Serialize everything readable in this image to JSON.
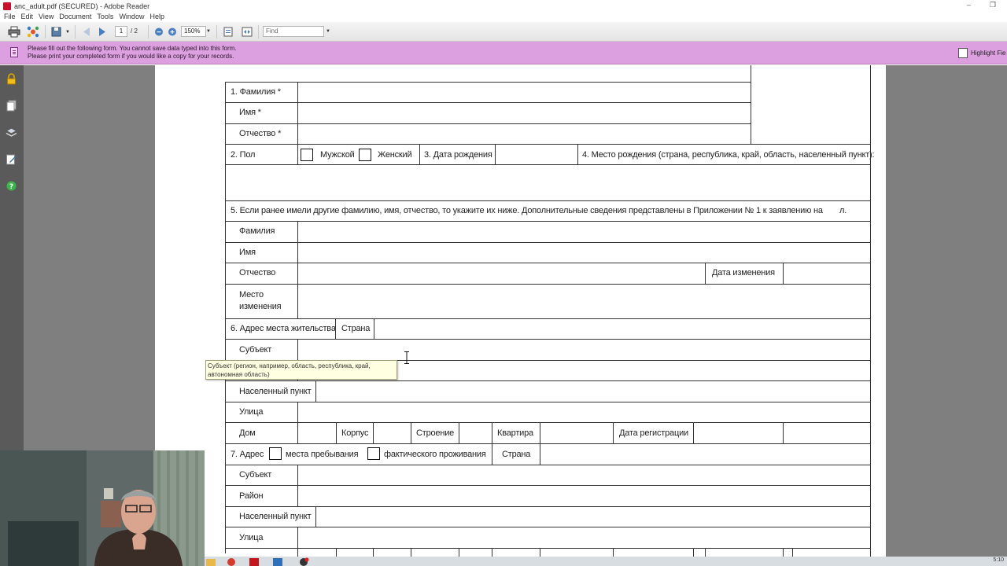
{
  "window": {
    "title": "anc_adult.pdf (SECURED) - Adobe Reader",
    "controls": [
      "–",
      "❐"
    ]
  },
  "menu": [
    "File",
    "Edit",
    "View",
    "Document",
    "Tools",
    "Window",
    "Help"
  ],
  "toolbar": {
    "page_current": "1",
    "page_total": "/ 2",
    "zoom": "150%",
    "find_placeholder": "Find"
  },
  "message_bar": {
    "line1": "Please fill out the following form. You cannot save data typed into this form.",
    "line2": "Please print your completed form if you would like a copy for your records.",
    "highlight_button": "Highlight Fie"
  },
  "form": {
    "surname_label": "1. Фамилия *",
    "name_label": "Имя *",
    "patronymic_label": "Отчество *",
    "sex_label": "2. Пол",
    "male_label": "Мужской",
    "female_label": "Женский",
    "birthdate_label": "3. Дата рождения",
    "birthplace_label": "4. Место рождения (страна, республика, край, область, населенный пункт):",
    "prev_names_text": "5. Если ранее имели другие фамилию, имя, отчество, то укажите их ниже. Дополнительные сведения представлены в Приложении № 1 к заявлению на",
    "prev_names_suffix": "л.",
    "prev_surname_label": "Фамилия",
    "prev_name_label": "Имя",
    "prev_patronymic_label": "Отчество",
    "change_date_label": "Дата изменения",
    "change_place_label_1": "Место",
    "change_place_label_2": "изменения",
    "residence_label": "6. Адрес места жительства",
    "country_label": "Страна",
    "subject_label": "Субъект",
    "locality_label": "Населенный пункт",
    "street_label": "Улица",
    "house_label": "Дом",
    "korpus_label": "Корпус",
    "building_label": "Строение",
    "apartment_label": "Квартира",
    "registration_date_label": "Дата регистрации",
    "address7_label": "7. Адрес",
    "stay_place_label": "места пребывания",
    "actual_residence_label": "фактического проживания",
    "country7_label": "Страна",
    "subject7_label": "Субъект",
    "district7_label": "Район",
    "locality7_label": "Населенный пункт",
    "street7_label": "Улица"
  },
  "tooltip": "Субъект (регион, например, область, республика, край, автономная область)",
  "taskbar": {
    "clock": "5:10"
  },
  "colors": {
    "message_bar": "#dc9fe0",
    "nav_pane": "#5a5a5a",
    "viewer_bg": "#7f7f7f",
    "tooltip_bg": "#ffffe1"
  },
  "icons": [
    "print-icon",
    "collaborate-icon",
    "save-icon",
    "prev-page-icon",
    "next-page-icon",
    "zoom-out-icon",
    "zoom-in-icon",
    "fit-page-icon",
    "fit-width-icon",
    "lock-icon",
    "pages-icon",
    "layers-icon",
    "sign-icon",
    "help-icon",
    "highlight-fields-icon"
  ]
}
